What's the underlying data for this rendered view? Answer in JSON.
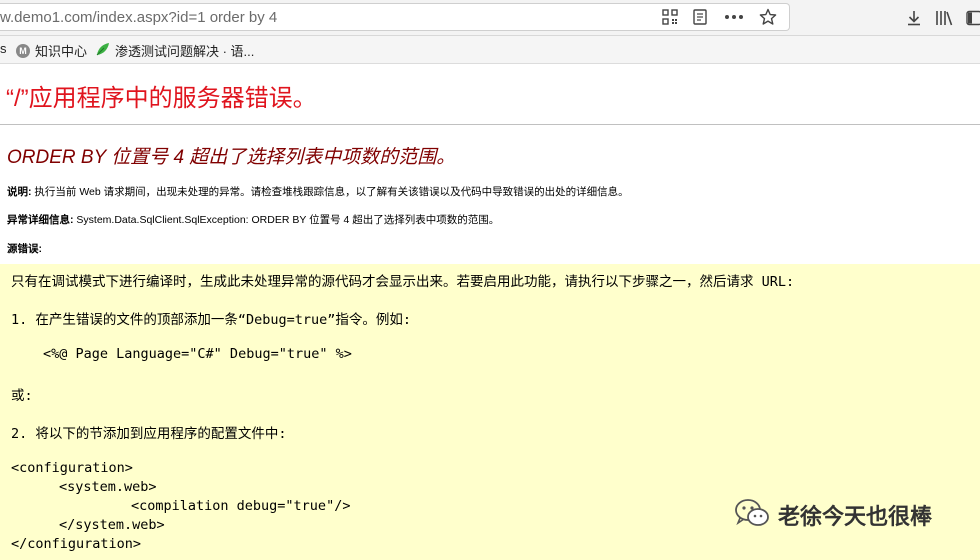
{
  "browser": {
    "url": "w.demo1.com/index.aspx?id=1 order by 4",
    "icons": [
      "qr-code-icon",
      "reader-view-icon",
      "more-actions-icon",
      "bookmark-star-icon",
      "download-icon",
      "library-icon",
      "sidebar-icon"
    ]
  },
  "bookmarks": {
    "items": [
      {
        "label": "知识中心",
        "icon": "m-favicon-icon"
      },
      {
        "label": "渗透测试问题解决 · 语...",
        "icon": "leaf-favicon-icon"
      }
    ]
  },
  "page": {
    "title": "“/”应用程序中的服务器错误。",
    "subtitle": "ORDER BY 位置号 4 超出了选择列表中项数的范围。",
    "description_label": "说明:",
    "description_text": " 执行当前 Web 请求期间，出现未处理的异常。请检查堆栈跟踪信息，以了解有关该错误以及代码中导致错误的出处的详细信息。",
    "exception_label": "异常详细信息:",
    "exception_text": " System.Data.SqlClient.SqlException: ORDER BY 位置号 4 超出了选择列表中项数的范围。",
    "source_label": "源错误:"
  },
  "code": {
    "intro": "只有在调试模式下进行编译时，生成此未处理异常的源代码才会显示出来。若要启用此功能，请执行以下步骤之一，然后请求 URL:",
    "step1": "1. 在产生错误的文件的顶部添加一条“Debug=true”指令。例如:",
    "step1_code": "<%@ Page Language=\"C#\" Debug=\"true\" %>",
    "or": "或:",
    "step2": "2. 将以下的节添加到应用程序的配置文件中:",
    "config_lines": [
      "<configuration>",
      "<system.web>",
      "<compilation debug=\"true\"/>",
      "</system.web>",
      "</configuration>"
    ]
  },
  "watermark": {
    "text": "老徐今天也很棒",
    "icon": "wechat-icon"
  },
  "colors": {
    "title_red": "#e0141e",
    "subtitle_maroon": "#800000",
    "code_bg": "#ffffcc"
  }
}
